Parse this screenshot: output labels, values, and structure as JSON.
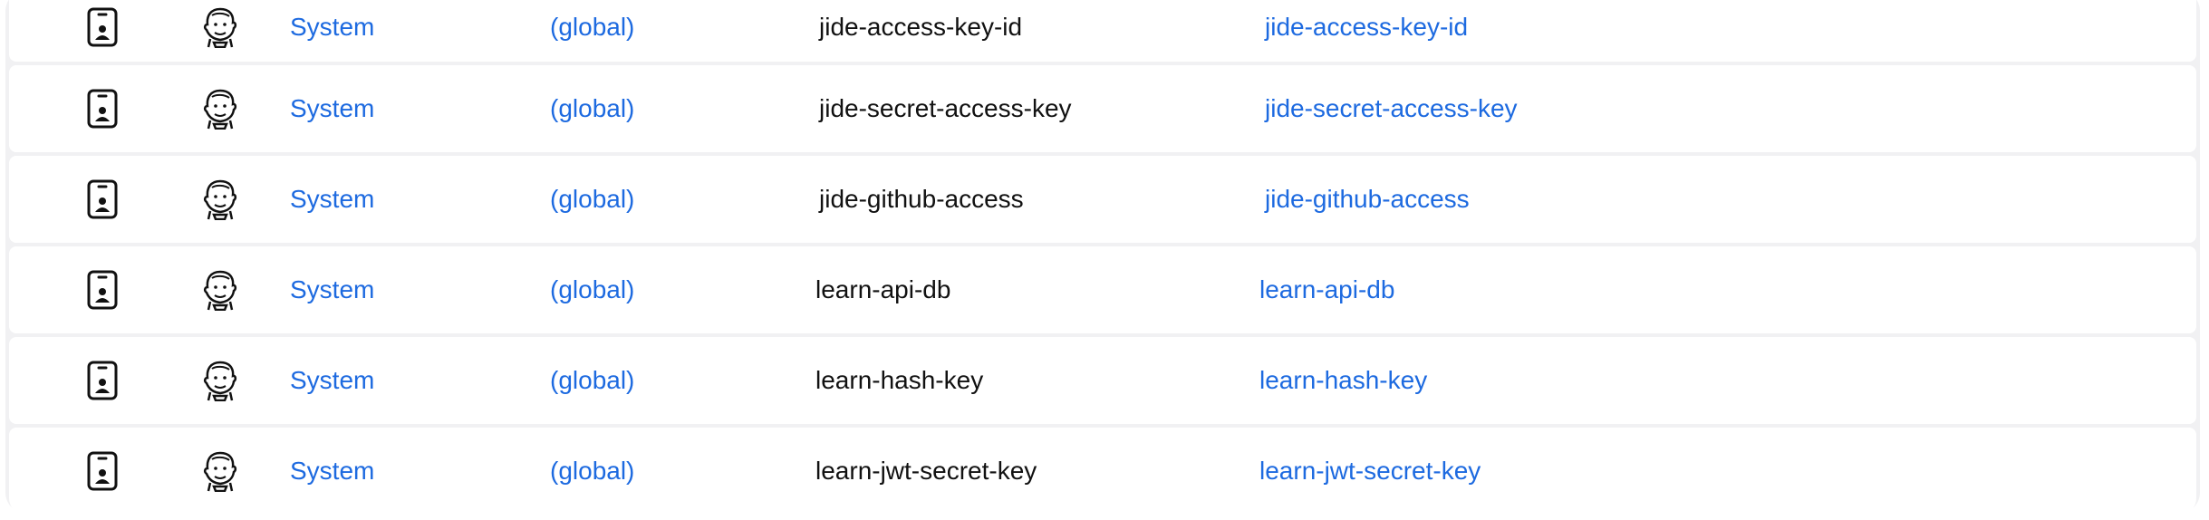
{
  "colors": {
    "link": "#1d6ae0",
    "text": "#111111",
    "table_bg": "#f1f1f3",
    "row_bg": "#ffffff"
  },
  "icons": {
    "store": "mobile-credential-icon",
    "provider": "jenkins-icon"
  },
  "credentials": [
    {
      "store": "System",
      "domain": "(global)",
      "id": "jide-access-key-id",
      "name": "jide-access-key-id"
    },
    {
      "store": "System",
      "domain": "(global)",
      "id": "jide-secret-access-key",
      "name": "jide-secret-access-key"
    },
    {
      "store": "System",
      "domain": "(global)",
      "id": "jide-github-access",
      "name": "jide-github-access"
    },
    {
      "store": "System",
      "domain": "(global)",
      "id": "learn-api-db",
      "name": "learn-api-db"
    },
    {
      "store": "System",
      "domain": "(global)",
      "id": "learn-hash-key",
      "name": "learn-hash-key"
    },
    {
      "store": "System",
      "domain": "(global)",
      "id": "learn-jwt-secret-key",
      "name": "learn-jwt-secret-key"
    }
  ]
}
